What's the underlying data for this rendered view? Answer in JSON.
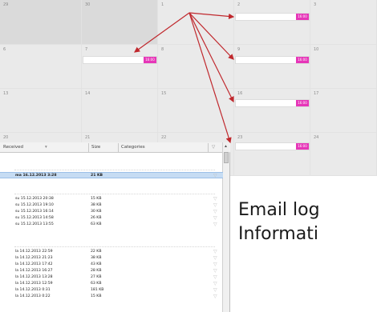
{
  "calendar": {
    "day_numbers": [
      "29",
      "30",
      "1",
      "2",
      "3",
      "6",
      "7",
      "8",
      "9",
      "10",
      "13",
      "14",
      "15",
      "16",
      "17",
      "20",
      "21",
      "22",
      "23",
      "24"
    ],
    "event_tag": "16:00"
  },
  "mail_list": {
    "columns": {
      "received": "Received",
      "size": "Size",
      "categories": "Categories"
    },
    "groups": [
      [
        {
          "received": "ma 16.12.2013 3:28",
          "size": "21 KB",
          "selected": true
        }
      ],
      [
        {
          "received": "su 15.12.2013 20:38",
          "size": "15 KB"
        },
        {
          "received": "su 15.12.2013 19:10",
          "size": "38 KB"
        },
        {
          "received": "su 15.12.2013 16:14",
          "size": "30 KB"
        },
        {
          "received": "su 15.12.2013 14:58",
          "size": "26 KB"
        },
        {
          "received": "su 15.12.2013 13:55",
          "size": "63 KB"
        }
      ],
      [
        {
          "received": "la 14.12.2013 22:59",
          "size": "22 KB"
        },
        {
          "received": "la 14.12.2013 21:23",
          "size": "38 KB"
        },
        {
          "received": "la 14.12.2013 17:42",
          "size": "43 KB"
        },
        {
          "received": "la 14.12.2013 16:27",
          "size": "28 KB"
        },
        {
          "received": "la 14.12.2013 13:28",
          "size": "27 KB"
        },
        {
          "received": "la 14.12.2013 12:59",
          "size": "63 KB"
        },
        {
          "received": "la 14.12.2013 0:31",
          "size": "181 KB"
        },
        {
          "received": "la 14.12.2013 0:22",
          "size": "15 KB"
        }
      ]
    ]
  },
  "caption": {
    "line1": "Email log",
    "line2": "Informati"
  },
  "colors": {
    "event_tag": "#e636b8",
    "arrow": "#c0282d",
    "selection": "#c6dcf3"
  }
}
